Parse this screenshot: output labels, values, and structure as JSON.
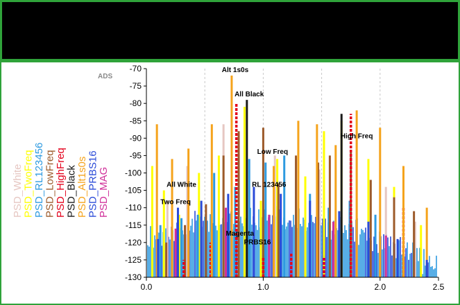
{
  "chart_data": {
    "type": "bar",
    "title": "",
    "xlabel": "",
    "ylabel": "",
    "watermark": "ADS",
    "xlim": [
      0.0,
      2.5
    ],
    "ylim": [
      -130,
      -70
    ],
    "xticks": [
      "0.0",
      "1.0",
      "2.0",
      "2.5"
    ],
    "yticks": [
      "-70",
      "-75",
      "-80",
      "-85",
      "-90",
      "-95",
      "-100",
      "-105",
      "-110",
      "-115",
      "-120",
      "-125",
      "-130"
    ],
    "grid": "vertical dashed",
    "legend_placement": "left, rotated vertical",
    "series": [
      {
        "name": "PSD_White",
        "color": "#e6c7c2",
        "peaks": [
          [
            0.18,
            -108
          ],
          [
            0.35,
            -98
          ],
          [
            0.66,
            -86
          ],
          [
            0.84,
            -92
          ],
          [
            1.1,
            -95
          ],
          [
            1.48,
            -99
          ],
          [
            1.8,
            -88
          ],
          [
            2.05,
            -104
          ],
          [
            2.3,
            -114
          ]
        ]
      },
      {
        "name": "PSD_TwoFreq",
        "color": "#ffff00",
        "peaks": [
          [
            0.05,
            -98
          ],
          [
            0.15,
            -105
          ],
          [
            0.28,
            -112
          ],
          [
            0.45,
            -100
          ],
          [
            0.62,
            -95
          ],
          [
            0.84,
            -81
          ],
          [
            0.98,
            -108
          ],
          [
            1.12,
            -96
          ],
          [
            1.36,
            -101
          ],
          [
            1.52,
            -88
          ],
          [
            1.67,
            -85
          ],
          [
            1.9,
            -96
          ],
          [
            2.12,
            -104
          ],
          [
            2.35,
            -115
          ]
        ]
      },
      {
        "name": "PSD_RL123456",
        "color": "#2e9ae0",
        "peaks": [
          [
            0.12,
            -115
          ],
          [
            0.3,
            -113
          ],
          [
            0.44,
            -112
          ],
          [
            0.58,
            -100
          ],
          [
            0.76,
            -104
          ],
          [
            0.88,
            -96
          ],
          [
            1.02,
            -97
          ],
          [
            1.18,
            -95
          ],
          [
            1.28,
            -102
          ],
          [
            1.4,
            -106
          ],
          [
            1.56,
            -110
          ],
          [
            1.74,
            -108
          ],
          [
            1.96,
            -112
          ],
          [
            2.2,
            -118
          ]
        ]
      },
      {
        "name": "PSD_LowFreq",
        "color": "#9c5a2a",
        "peaks": [
          [
            0.17,
            -120
          ],
          [
            0.33,
            -115
          ],
          [
            0.51,
            -109
          ],
          [
            0.66,
            -95
          ],
          [
            0.79,
            -88
          ],
          [
            1.0,
            -87
          ],
          [
            1.13,
            -103
          ],
          [
            1.28,
            -95
          ],
          [
            1.47,
            -97
          ],
          [
            1.57,
            -95
          ],
          [
            1.75,
            -94
          ],
          [
            1.92,
            -102
          ],
          [
            2.12,
            -107
          ],
          [
            2.29,
            -111
          ]
        ]
      },
      {
        "name": "PSD_HighFreq",
        "color": "#e3001b",
        "peaks": [
          [
            0.32,
            -125
          ],
          [
            0.55,
            -120
          ],
          [
            0.77,
            -80
          ],
          [
            1.0,
            -124
          ],
          [
            1.24,
            -123
          ],
          [
            1.52,
            -124
          ],
          [
            1.75,
            -83
          ],
          [
            2.2,
            -110
          ]
        ]
      },
      {
        "name": "PSD_Black",
        "color": "#1a1a1a",
        "peaks": [
          [
            0.86,
            -79
          ],
          [
            1.67,
            -83
          ]
        ]
      },
      {
        "name": "PSD_Alt1s0s",
        "color": "#f5a31b",
        "peaks": [
          [
            0.09,
            -86
          ],
          [
            0.22,
            -96
          ],
          [
            0.36,
            -93
          ],
          [
            0.56,
            -86
          ],
          [
            0.73,
            -72
          ],
          [
            1.09,
            -98
          ],
          [
            1.3,
            -85
          ],
          [
            1.46,
            -86
          ],
          [
            1.62,
            -92
          ],
          [
            1.8,
            -82
          ],
          [
            2.0,
            -87
          ],
          [
            2.2,
            -98
          ],
          [
            2.4,
            -110
          ]
        ]
      },
      {
        "name": "PSD_PRBS16",
        "color": "#2a4ad8",
        "peaks": [
          [
            0.1,
            -119
          ],
          [
            0.27,
            -110
          ],
          [
            0.47,
            -108
          ],
          [
            0.7,
            -106
          ],
          [
            0.92,
            -104
          ],
          [
            1.15,
            -106
          ],
          [
            1.4,
            -108
          ],
          [
            1.65,
            -111
          ],
          [
            1.9,
            -114
          ],
          [
            2.15,
            -119
          ],
          [
            2.4,
            -125
          ]
        ]
      },
      {
        "name": "PSD_MAG",
        "color": "#d0309a",
        "peaks": [
          [
            0.25,
            -116
          ],
          [
            0.68,
            -110
          ],
          [
            1.05,
            -112
          ],
          [
            1.6,
            -114
          ],
          [
            2.05,
            -118
          ]
        ]
      }
    ],
    "annotations": [
      {
        "text": "Alt 1s0s",
        "x": 0.76,
        "y": -71
      },
      {
        "text": "All Black",
        "x": 0.88,
        "y": -78
      },
      {
        "text": "High Freq",
        "x": 1.8,
        "y": -90
      },
      {
        "text": "Low Freq",
        "x": 1.08,
        "y": -94.5
      },
      {
        "text": "All White",
        "x": 0.3,
        "y": -104
      },
      {
        "text": "RL 123456",
        "x": 1.05,
        "y": -104
      },
      {
        "text": "Two Freq",
        "x": 0.25,
        "y": -109
      },
      {
        "text": "Magenta",
        "x": 0.8,
        "y": -118
      },
      {
        "text": "PRBS16",
        "x": 0.95,
        "y": -120.5
      }
    ]
  }
}
